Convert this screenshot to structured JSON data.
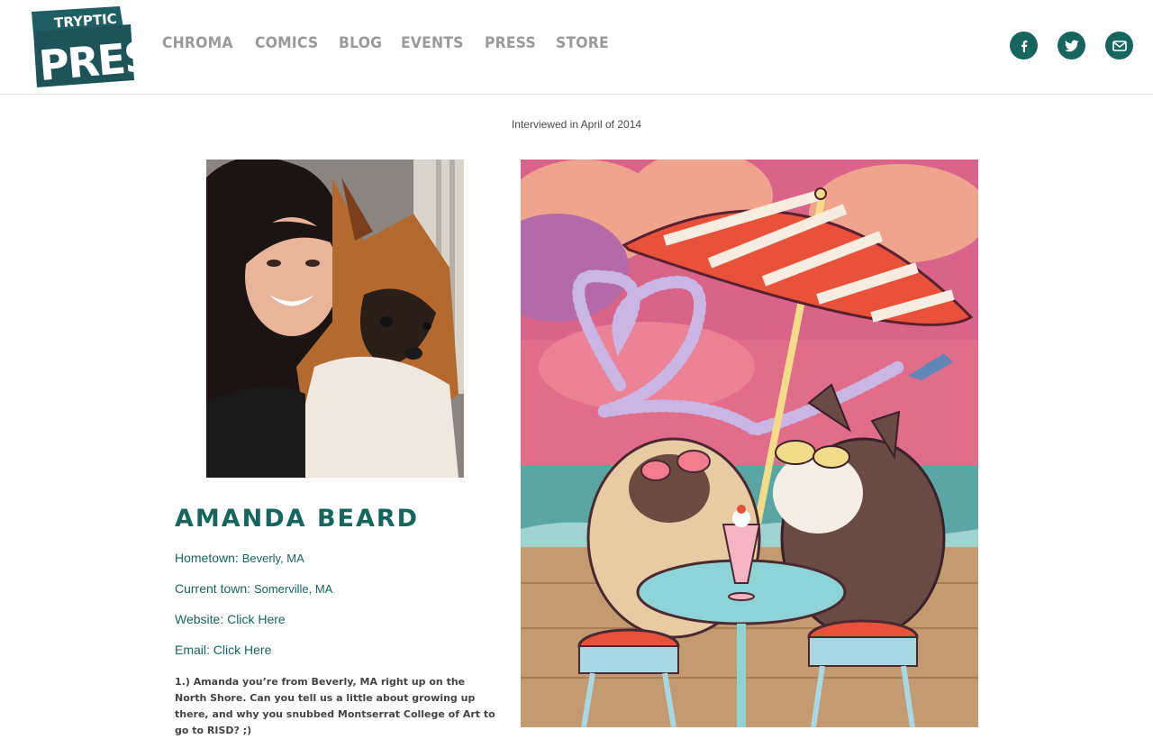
{
  "site": {
    "logo_top": "TRYPTIC",
    "logo_main": "PRESS",
    "nav": [
      {
        "label": "CHROMA"
      },
      {
        "label": "COMICS"
      },
      {
        "label": "BLOG"
      },
      {
        "label": "EVENTS"
      },
      {
        "label": "PRESS"
      },
      {
        "label": "STORE"
      }
    ],
    "social": [
      {
        "icon": "facebook-icon"
      },
      {
        "icon": "twitter-icon"
      },
      {
        "icon": "email-icon"
      }
    ],
    "accent": "#17665d"
  },
  "interview": {
    "date_text": "Interviewed in April of 2014",
    "artist_name": "AMANDA BEARD",
    "fields": {
      "hometown_label": "Hometown:",
      "hometown_value": "Beverly,  MA",
      "current_label": "Current town:",
      "current_value": "Somerville,  MA",
      "website_label": "Website:",
      "website_link": "Click Here",
      "email_label": "Email:",
      "email_link": "Click Here"
    },
    "question_1": "1.) Amanda you’re from Beverly, MA right up on the North Shore. Can you tell us a little about growing up there, and why you snubbed Montserrat College of Art to go to RISD? ;)"
  }
}
